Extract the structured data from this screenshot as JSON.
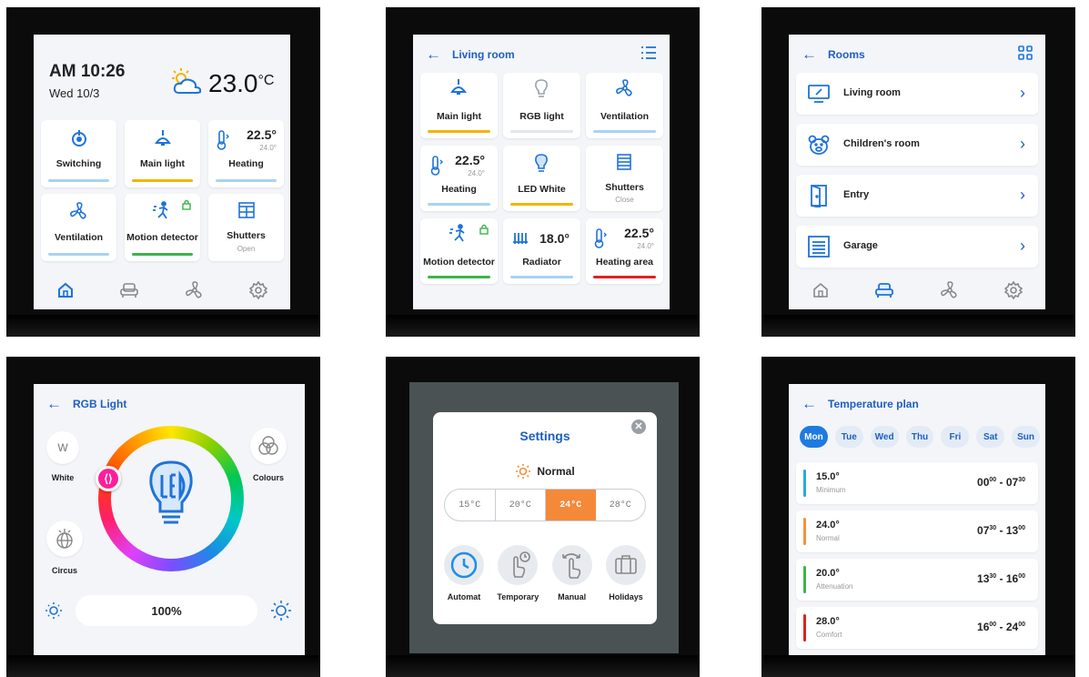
{
  "home": {
    "time": "AM 10:26",
    "date": "Wed 10/3",
    "temp": "23.0",
    "unit": "°C",
    "tiles": [
      {
        "label": "Switching",
        "bar": "#a9d3f3"
      },
      {
        "label": "Main light",
        "bar": "#f4b400"
      },
      {
        "label": "Heating",
        "value": "22.5°",
        "sub": "24.0°",
        "bar": "#a9d3f3"
      },
      {
        "label": "Ventilation",
        "bar": "#a9d3f3"
      },
      {
        "label": "Motion detector",
        "bar": "#3ab54a"
      },
      {
        "label": "Shutters",
        "sub": "Open",
        "bar": ""
      }
    ]
  },
  "living": {
    "title": "Living room",
    "tiles": [
      {
        "label": "Main light",
        "bar": "#f4b400"
      },
      {
        "label": "RGB light",
        "bar": "#e3e6ea"
      },
      {
        "label": "Ventilation",
        "bar": "#a9d3f3"
      },
      {
        "label": "Heating",
        "value": "22.5°",
        "sub": "24.0°",
        "bar": "#a9d3f3"
      },
      {
        "label": "LED White",
        "bar": "#f4b400"
      },
      {
        "label": "Shutters",
        "sub": "Close",
        "bar": ""
      },
      {
        "label": "Motion detector",
        "bar": "#3ab54a"
      },
      {
        "label": "Radiator",
        "value": "18.0°",
        "bar": "#a9d3f3"
      },
      {
        "label": "Heating area",
        "value": "22.5°",
        "sub": "24.0°",
        "bar": "#e02020"
      }
    ]
  },
  "rooms": {
    "title": "Rooms",
    "items": [
      "Living room",
      "Children's room",
      "Entry",
      "Garage"
    ]
  },
  "rgb": {
    "title": "RGB Light",
    "white_letter": "W",
    "white": "White",
    "colours": "Colours",
    "circus": "Circus",
    "brightness": "100%"
  },
  "settings": {
    "title": "Settings",
    "mode": "Normal",
    "temps": [
      "15°C",
      "20°C",
      "24°C",
      "28°C"
    ],
    "modes": [
      "Automat",
      "Temporary",
      "Manual",
      "Holidays"
    ]
  },
  "plan": {
    "title": "Temperature plan",
    "days": [
      "Mon",
      "Tue",
      "Wed",
      "Thu",
      "Fri",
      "Sat",
      "Sun"
    ],
    "rows": [
      {
        "temp": "15.0°",
        "name": "Minimum",
        "color": "#2aa7e8",
        "from": "00",
        "fromSup": "00",
        "to": "07",
        "toSup": "30"
      },
      {
        "temp": "24.0°",
        "name": "Normal",
        "color": "#f4923a",
        "from": "07",
        "fromSup": "30",
        "to": "13",
        "toSup": "00"
      },
      {
        "temp": "20.0°",
        "name": "Attenuation",
        "color": "#3ab54a",
        "from": "13",
        "fromSup": "30",
        "to": "16",
        "toSup": "00"
      },
      {
        "temp": "28.0°",
        "name": "Comfort",
        "color": "#e02020",
        "from": "16",
        "fromSup": "00",
        "to": "24",
        "toSup": "00"
      }
    ]
  }
}
